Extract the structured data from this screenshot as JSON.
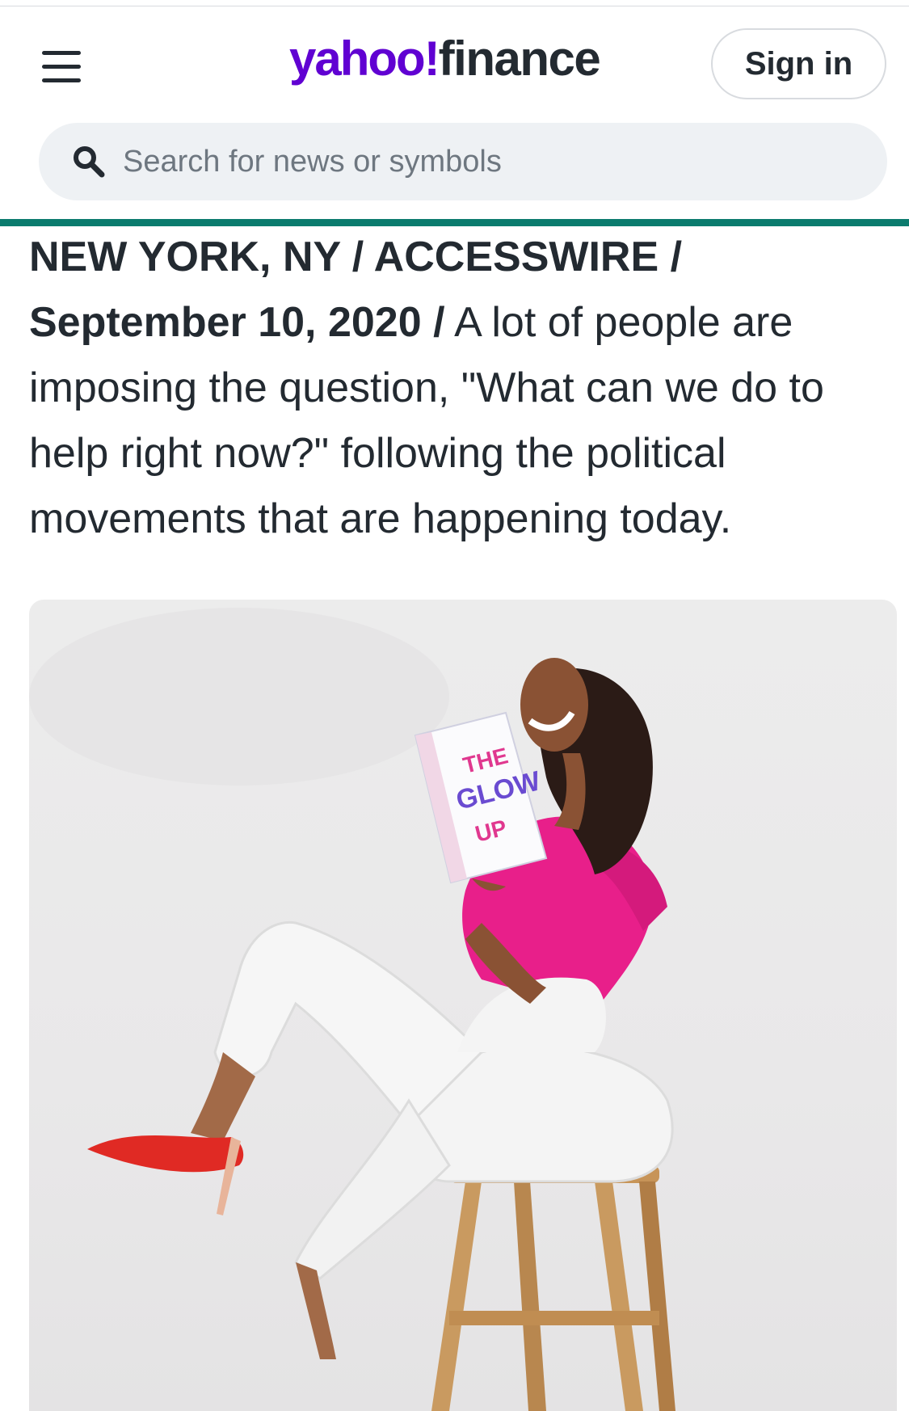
{
  "header": {
    "menu_icon": "hamburger-menu-icon",
    "logo": {
      "yahoo": "yahoo!",
      "finance": "finance",
      "brand_color": "#6001d2"
    },
    "sign_in_label": "Sign in"
  },
  "search": {
    "placeholder": "Search for news or symbols",
    "icon": "search-icon"
  },
  "accent_color": "#0b7b6e",
  "article": {
    "dateline": "NEW YORK, NY / ACCESSWIRE / September 10, 2020 /",
    "body": "A lot of people are imposing the question, \"What can we do to help right now?\" following the political movements that are happening today."
  },
  "photo": {
    "book_title_line1": "THE",
    "book_title_line2": "GLOW",
    "book_title_line3": "UP"
  }
}
